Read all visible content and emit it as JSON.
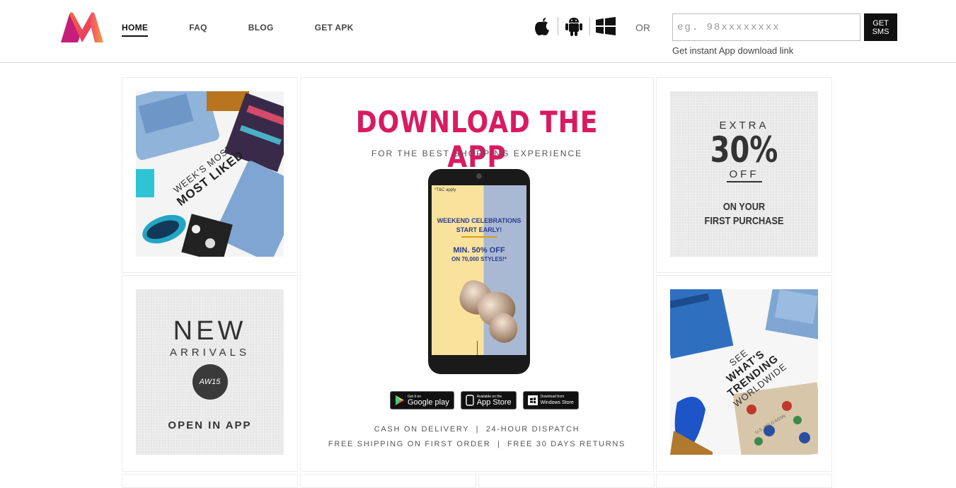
{
  "header": {
    "nav": [
      "HOME",
      "FAQ",
      "BLOG",
      "GET APK"
    ],
    "or_label": "OR",
    "phone_placeholder": "eg. 98xxxxxxxx",
    "sms_button": "GET\nSMS",
    "instant_link_text": "Get instant App download link",
    "brand_color": "#e72d6d"
  },
  "tiles": {
    "most_liked": {
      "line1": "WEEK'S MOST",
      "line2": "MOST LIKED"
    },
    "extra_off": {
      "line1": "EXTRA",
      "line2": "30%",
      "line3": "OFF",
      "line4": "ON YOUR",
      "line5": "FIRST PURCHASE"
    },
    "new_arrivals": {
      "line1": "NEW",
      "line2": "ARRIVALS",
      "badge": "AW15",
      "line3": "OPEN IN APP"
    },
    "trending": {
      "line1": "SEE",
      "line2": "WHAT'S",
      "line3": "TRENDING",
      "line4": "WORLDWIDE",
      "shorts_text": "U.S. POLO ASSN."
    }
  },
  "download": {
    "title": "DOWNLOAD THE APP",
    "subtitle": "FOR THE BEST SHOPPING EXPERIENCE",
    "screen_tc": "*T&C apply",
    "screen_line1": "WEEKEND CELEBRATIONS",
    "screen_line2": "START EARLY!",
    "screen_line3": "MIN. 50% OFF",
    "screen_line4": "ON 70,000 STYLES!*",
    "badges": [
      {
        "small": "Get it on",
        "big": "Google play"
      },
      {
        "small": "Available on the",
        "big": "App Store"
      },
      {
        "small": "Download from",
        "big": "Windows Store"
      }
    ],
    "footer1": "CASH ON DELIVERY  |  24-HOUR DISPATCH",
    "footer2": "FREE SHIPPING ON FIRST ORDER  |  FREE 30 DAYS RETURNS",
    "title_color": "#d81b60"
  }
}
